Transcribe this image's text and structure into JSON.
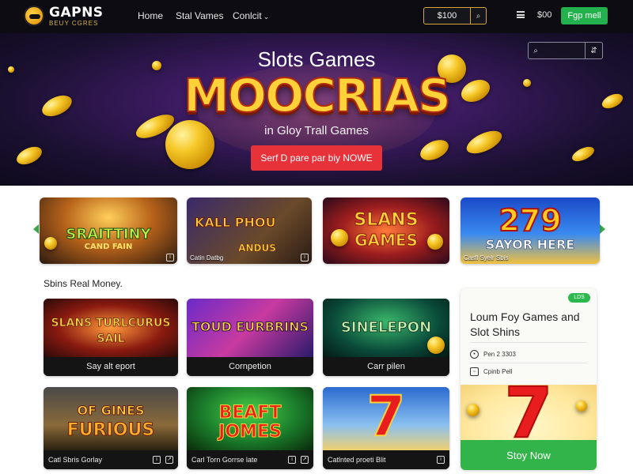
{
  "nav": {
    "logo_text": "GAPNS",
    "logo_sub": "BEUY CGRES",
    "links": [
      "Home",
      "Stal Vames",
      "Conlcit"
    ],
    "search_value": "$100",
    "balance": "$00",
    "cta": "Fgp mell"
  },
  "hero": {
    "subtitle_top": "Slots Games",
    "title": "MOOCRIAS",
    "subtitle_bottom": "in Gloy Trall Games",
    "cta": "Serf D pare par biy NOWE"
  },
  "featured": [
    {
      "title": "SRAITTINY",
      "title2": "CAND FAIN",
      "caption": ""
    },
    {
      "title": "KALL PHOU",
      "title2": "ANDUS",
      "caption": "Catin Datbg"
    },
    {
      "title": "SLANS",
      "title2": "GAMES",
      "caption": ""
    },
    {
      "title": "279",
      "title2": "SAYOR HERE",
      "caption": "Casfl Syelr Sbis"
    }
  ],
  "section_title": "Sbins Real Money.",
  "grid": [
    {
      "title": "SLANS TURLCURUS",
      "title2": "SAIL",
      "label": "Say alt eport"
    },
    {
      "title": "TOUD EURBRINS",
      "title2": "",
      "label": "Cornpetion"
    },
    {
      "title": "SINELEPON",
      "title2": "",
      "label": "Carr pilen"
    },
    {
      "title": "OF GINES",
      "title2": "FURIOUS",
      "label": "Catl Sbris Gorlay"
    },
    {
      "title": "BEAFT",
      "title2": "JOMES",
      "label": "Carl Torn Gorrse late"
    },
    {
      "title": "7",
      "title2": "",
      "label": "Catlnted proeti Blit"
    }
  ],
  "promo": {
    "badge": "LDS",
    "title": "Loum Foy Games and Slot Shins",
    "row1": "Pen 2 3303",
    "row2": "Cpinb Pell",
    "cta": "Stoy Now"
  },
  "colors": {
    "nav_bg": "#0c0c12",
    "accent_green": "#22b14c",
    "hero_cta_red": "#e8323a",
    "gold": "#ffd23a"
  }
}
